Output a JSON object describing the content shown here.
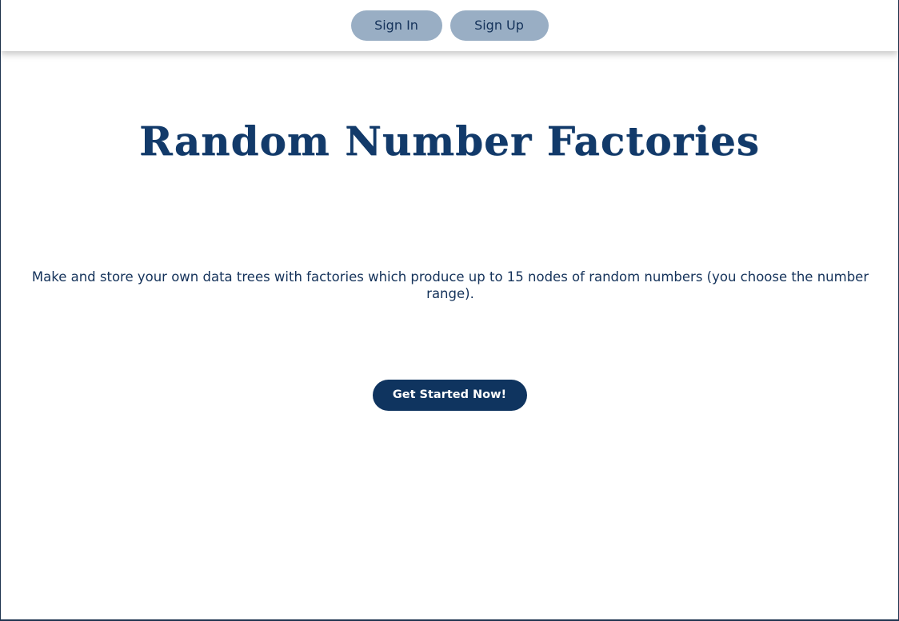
{
  "header": {
    "sign_in_label": "Sign In",
    "sign_up_label": "Sign Up"
  },
  "hero": {
    "title": "Random Number Factories",
    "description": "Make and store your own data trees with factories which produce up to 15 nodes of random numbers (you choose the number range).",
    "cta_label": "Get Started Now!"
  },
  "colors": {
    "nav_button_bg": "#99aec4",
    "primary_text": "#14325a",
    "title_text": "#123a6a",
    "cta_bg": "#0f345f",
    "cta_text": "#ffffff"
  }
}
